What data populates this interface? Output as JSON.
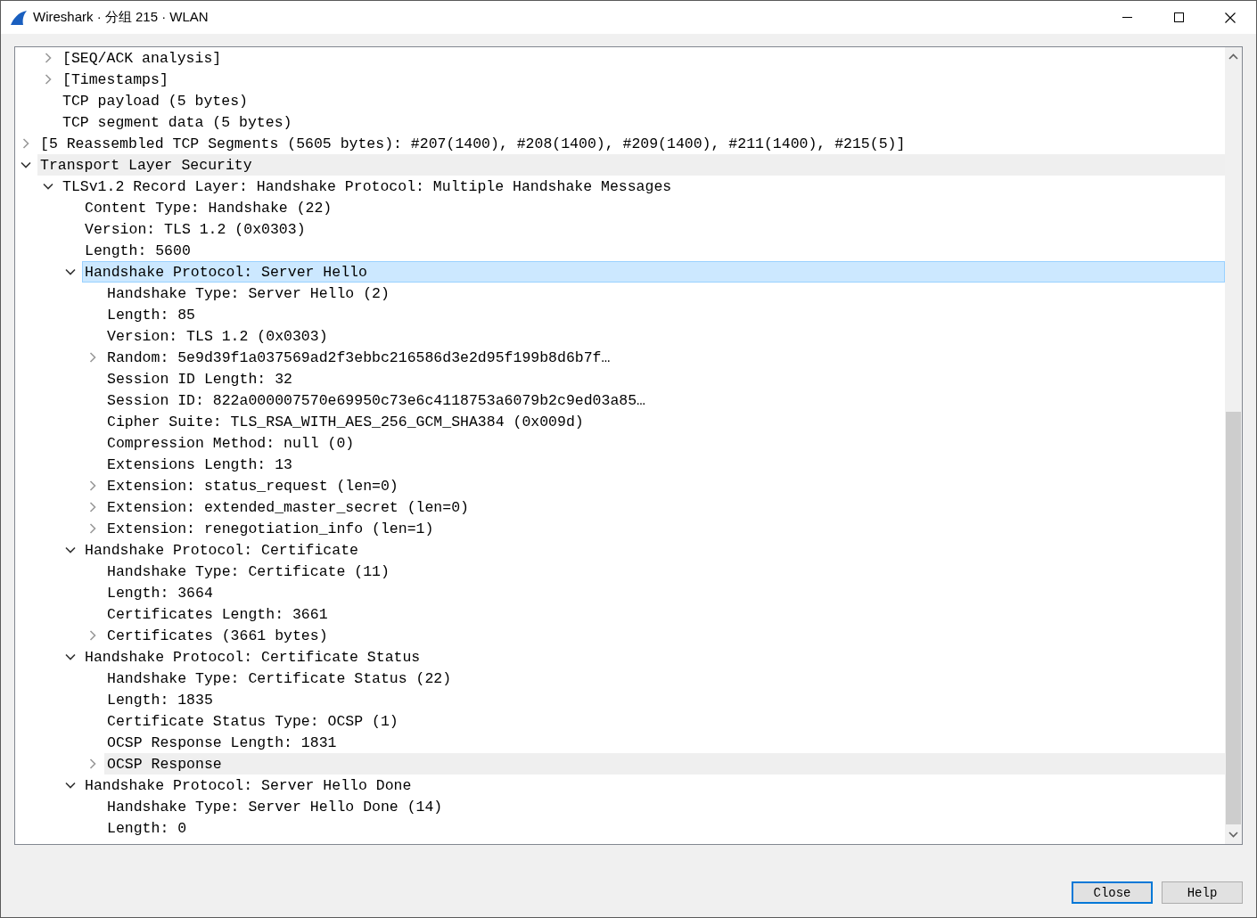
{
  "window": {
    "title": "Wireshark · 分组 215 · WLAN"
  },
  "tree": {
    "scrolled_parent_children": [
      {
        "label": "[SEQ/ACK analysis]",
        "kind": "branch",
        "expanded": false,
        "selected": false,
        "highlighted": false
      },
      {
        "label": "[Timestamps]",
        "kind": "branch",
        "expanded": false,
        "selected": false,
        "highlighted": false
      },
      {
        "label": "TCP payload (5 bytes)",
        "kind": "leaf",
        "selected": false,
        "highlighted": false
      },
      {
        "label": "TCP segment data (5 bytes)",
        "kind": "leaf",
        "selected": false,
        "highlighted": false
      }
    ],
    "items": [
      {
        "label": "[5 Reassembled TCP Segments (5605 bytes): #207(1400), #208(1400), #209(1400), #211(1400), #215(5)]",
        "kind": "branch",
        "expanded": false,
        "selected": false,
        "highlighted": false
      },
      {
        "label": "Transport Layer Security",
        "kind": "branch",
        "expanded": true,
        "selected": false,
        "highlighted": true,
        "children": [
          {
            "label": "TLSv1.2 Record Layer: Handshake Protocol: Multiple Handshake Messages",
            "kind": "branch",
            "expanded": true,
            "selected": false,
            "highlighted": false,
            "children": [
              {
                "label": "Content Type: Handshake (22)",
                "kind": "leaf",
                "selected": false,
                "highlighted": false
              },
              {
                "label": "Version: TLS 1.2 (0x0303)",
                "kind": "leaf",
                "selected": false,
                "highlighted": false
              },
              {
                "label": "Length: 5600",
                "kind": "leaf",
                "selected": false,
                "highlighted": false
              },
              {
                "label": "Handshake Protocol: Server Hello",
                "kind": "branch",
                "expanded": true,
                "selected": true,
                "highlighted": false,
                "children": [
                  {
                    "label": "Handshake Type: Server Hello (2)",
                    "kind": "leaf",
                    "selected": false,
                    "highlighted": false
                  },
                  {
                    "label": "Length: 85",
                    "kind": "leaf",
                    "selected": false,
                    "highlighted": false
                  },
                  {
                    "label": "Version: TLS 1.2 (0x0303)",
                    "kind": "leaf",
                    "selected": false,
                    "highlighted": false
                  },
                  {
                    "label": "Random: 5e9d39f1a037569ad2f3ebbc216586d3e2d95f199b8d6b7f…",
                    "kind": "branch",
                    "expanded": false,
                    "selected": false,
                    "highlighted": false
                  },
                  {
                    "label": "Session ID Length: 32",
                    "kind": "leaf",
                    "selected": false,
                    "highlighted": false
                  },
                  {
                    "label": "Session ID: 822a000007570e69950c73e6c4118753a6079b2c9ed03a85…",
                    "kind": "leaf",
                    "selected": false,
                    "highlighted": false
                  },
                  {
                    "label": "Cipher Suite: TLS_RSA_WITH_AES_256_GCM_SHA384 (0x009d)",
                    "kind": "leaf",
                    "selected": false,
                    "highlighted": false
                  },
                  {
                    "label": "Compression Method: null (0)",
                    "kind": "leaf",
                    "selected": false,
                    "highlighted": false
                  },
                  {
                    "label": "Extensions Length: 13",
                    "kind": "leaf",
                    "selected": false,
                    "highlighted": false
                  },
                  {
                    "label": "Extension: status_request (len=0)",
                    "kind": "branch",
                    "expanded": false,
                    "selected": false,
                    "highlighted": false
                  },
                  {
                    "label": "Extension: extended_master_secret (len=0)",
                    "kind": "branch",
                    "expanded": false,
                    "selected": false,
                    "highlighted": false
                  },
                  {
                    "label": "Extension: renegotiation_info (len=1)",
                    "kind": "branch",
                    "expanded": false,
                    "selected": false,
                    "highlighted": false
                  }
                ]
              },
              {
                "label": "Handshake Protocol: Certificate",
                "kind": "branch",
                "expanded": true,
                "selected": false,
                "highlighted": false,
                "children": [
                  {
                    "label": "Handshake Type: Certificate (11)",
                    "kind": "leaf",
                    "selected": false,
                    "highlighted": false
                  },
                  {
                    "label": "Length: 3664",
                    "kind": "leaf",
                    "selected": false,
                    "highlighted": false
                  },
                  {
                    "label": "Certificates Length: 3661",
                    "kind": "leaf",
                    "selected": false,
                    "highlighted": false
                  },
                  {
                    "label": "Certificates (3661 bytes)",
                    "kind": "branch",
                    "expanded": false,
                    "selected": false,
                    "highlighted": false
                  }
                ]
              },
              {
                "label": "Handshake Protocol: Certificate Status",
                "kind": "branch",
                "expanded": true,
                "selected": false,
                "highlighted": false,
                "children": [
                  {
                    "label": "Handshake Type: Certificate Status (22)",
                    "kind": "leaf",
                    "selected": false,
                    "highlighted": false
                  },
                  {
                    "label": "Length: 1835",
                    "kind": "leaf",
                    "selected": false,
                    "highlighted": false
                  },
                  {
                    "label": "Certificate Status Type: OCSP (1)",
                    "kind": "leaf",
                    "selected": false,
                    "highlighted": false
                  },
                  {
                    "label": "OCSP Response Length: 1831",
                    "kind": "leaf",
                    "selected": false,
                    "highlighted": false
                  },
                  {
                    "label": "OCSP Response",
                    "kind": "branch",
                    "expanded": false,
                    "selected": false,
                    "highlighted": true
                  }
                ]
              },
              {
                "label": "Handshake Protocol: Server Hello Done",
                "kind": "branch",
                "expanded": true,
                "selected": false,
                "highlighted": false,
                "children": [
                  {
                    "label": "Handshake Type: Server Hello Done (14)",
                    "kind": "leaf",
                    "selected": false,
                    "highlighted": false
                  },
                  {
                    "label": "Length: 0",
                    "kind": "leaf",
                    "selected": false,
                    "highlighted": false
                  }
                ]
              }
            ]
          }
        ]
      }
    ]
  },
  "buttons": [
    {
      "label": "Close",
      "selected": true
    },
    {
      "label": "Help",
      "selected": false
    }
  ]
}
